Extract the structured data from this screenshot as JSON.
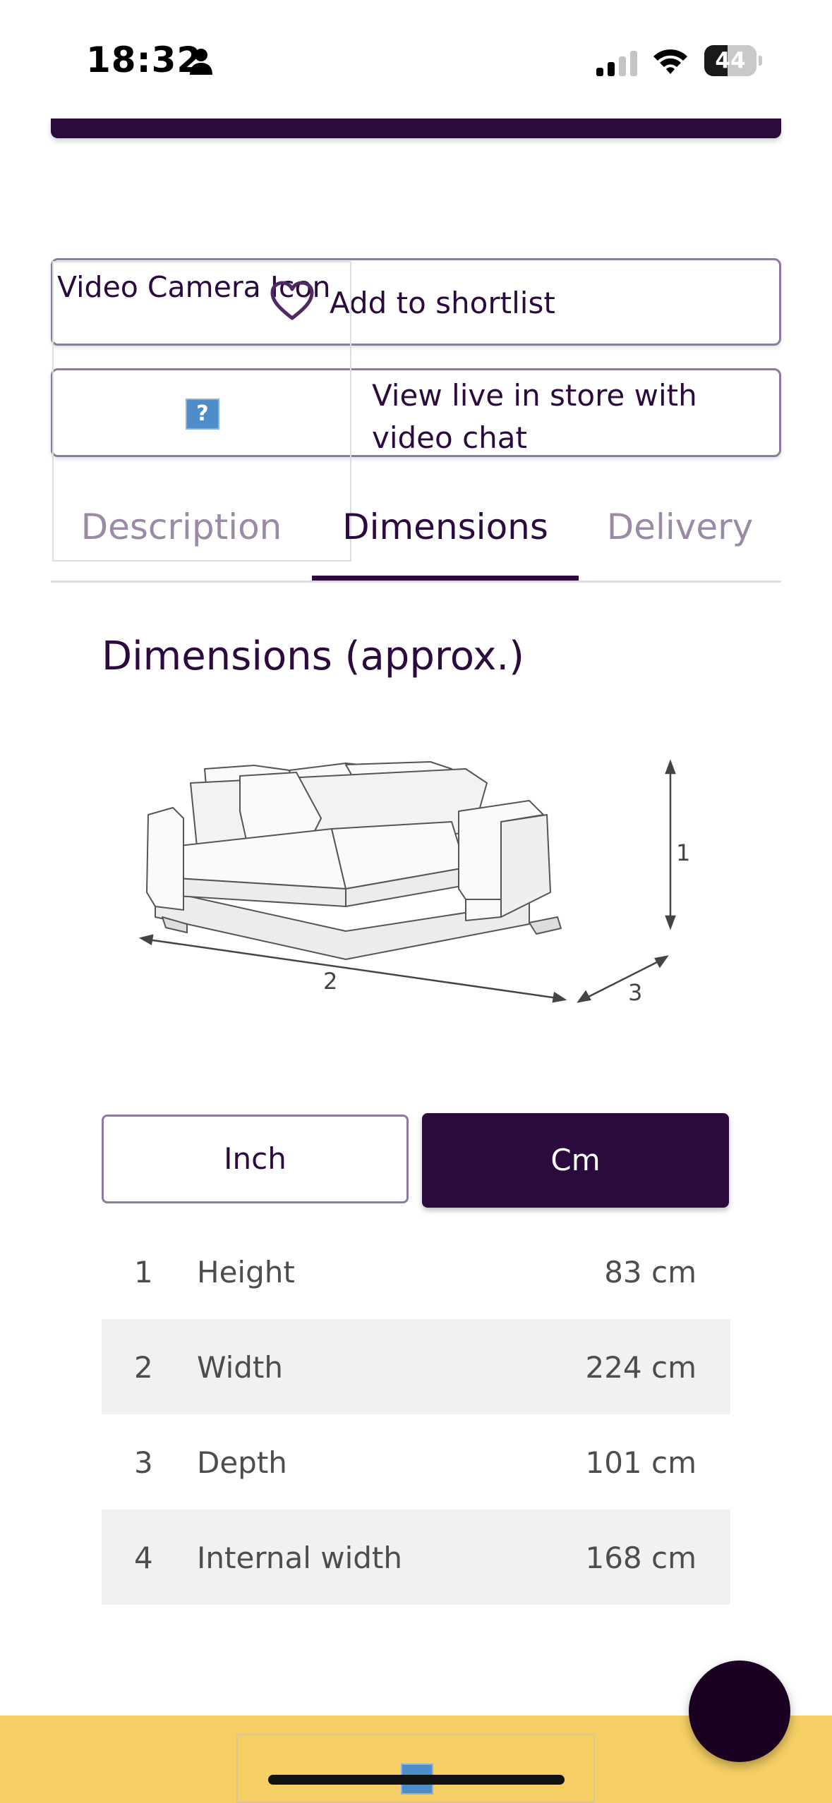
{
  "status_bar": {
    "time": "18:32",
    "battery": "44",
    "battery_level": 0.44,
    "icons": [
      "person-icon",
      "cellular-signal-icon",
      "wifi-icon",
      "battery-icon"
    ]
  },
  "actions": {
    "shortlist_label": "Add to shortlist",
    "shortlist_icon": "heart-icon",
    "video_alt_text": "Video Camera Icon",
    "video_label": "View live in store with video chat",
    "broken_image_glyph": "?"
  },
  "tabs": [
    {
      "label": "Description",
      "active": false
    },
    {
      "label": "Dimensions",
      "active": true
    },
    {
      "label": "Delivery",
      "active": false
    }
  ],
  "dimensions": {
    "title": "Dimensions (approx.)",
    "diagram_markers": [
      "1",
      "2",
      "3"
    ],
    "units": {
      "inch": "Inch",
      "cm": "Cm",
      "selected": "Cm"
    },
    "rows": [
      {
        "num": "1",
        "label": "Height",
        "value": "83 cm"
      },
      {
        "num": "2",
        "label": "Width",
        "value": "224 cm"
      },
      {
        "num": "3",
        "label": "Depth",
        "value": "101 cm"
      },
      {
        "num": "4",
        "label": "Internal width",
        "value": "168 cm"
      }
    ]
  },
  "colors": {
    "brand": "#2b0a3d",
    "footer": "#f5cf64",
    "inactive_tab": "#9a8aa5"
  },
  "chat_button": {
    "icon": "chat-icon"
  }
}
